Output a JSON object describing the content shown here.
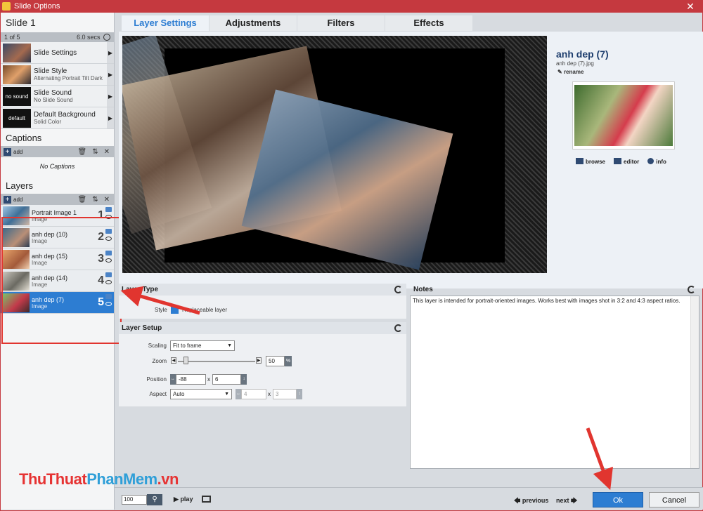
{
  "window": {
    "title": "Slide Options",
    "close_glyph": "✕"
  },
  "left": {
    "slide_title": "Slide 1",
    "slide_count": "1 of 5",
    "slide_duration": "6.0 secs",
    "options": [
      {
        "label": "Slide Settings",
        "sub": "",
        "thumb": ""
      },
      {
        "label": "Slide Style",
        "sub": "Alternating Portrait Tilt Dark",
        "thumb": ""
      },
      {
        "label": "Slide Sound",
        "sub": "No Slide Sound",
        "thumb": "no sound"
      },
      {
        "label": "Default Background",
        "sub": "Solid Color",
        "thumb": "default"
      }
    ],
    "captions_title": "Captions",
    "add_label": "add",
    "no_captions": "No Captions",
    "layers_title": "Layers",
    "layers": [
      {
        "name": "Portrait Image 1",
        "type": "Image",
        "num": "1"
      },
      {
        "name": "anh dep (10)",
        "type": "Image",
        "num": "2"
      },
      {
        "name": "anh dep (15)",
        "type": "Image",
        "num": "3"
      },
      {
        "name": "anh dep (14)",
        "type": "Image",
        "num": "4"
      },
      {
        "name": "anh dep (7)",
        "type": "Image",
        "num": "5"
      }
    ]
  },
  "tabs": [
    "Layer Settings",
    "Adjustments",
    "Filters",
    "Effects"
  ],
  "info": {
    "name": "anh dep (7)",
    "file": "anh dep (7).jpg",
    "rename": "rename",
    "browse": "browse",
    "editor": "editor",
    "info": "info"
  },
  "layer_type": {
    "title": "Layer Type",
    "style_label": "Style",
    "check_label": "Replaceable layer"
  },
  "layer_setup": {
    "title": "Layer Setup",
    "scaling_label": "Scaling",
    "scaling_value": "Fit to frame",
    "zoom_label": "Zoom",
    "zoom_value": "50",
    "zoom_unit": "%",
    "position_label": "Position",
    "pos_x": "-88",
    "pos_y": "6",
    "x": "x",
    "aspect_label": "Aspect",
    "aspect_value": "Auto",
    "aspect_x": "4",
    "aspect_y": "3"
  },
  "notes": {
    "title": "Notes",
    "text": "This layer is intended for portrait-oriented images. Works best with images shot in 3:2 and 4:3 aspect ratios."
  },
  "bottom": {
    "zoom": "100",
    "play": "play",
    "previous": "previous",
    "next": "next",
    "ok": "Ok",
    "cancel": "Cancel"
  },
  "watermark": {
    "part1": "Thu",
    "part2": "Thuat",
    "part3": "PhanMem",
    "part4": ".vn"
  }
}
